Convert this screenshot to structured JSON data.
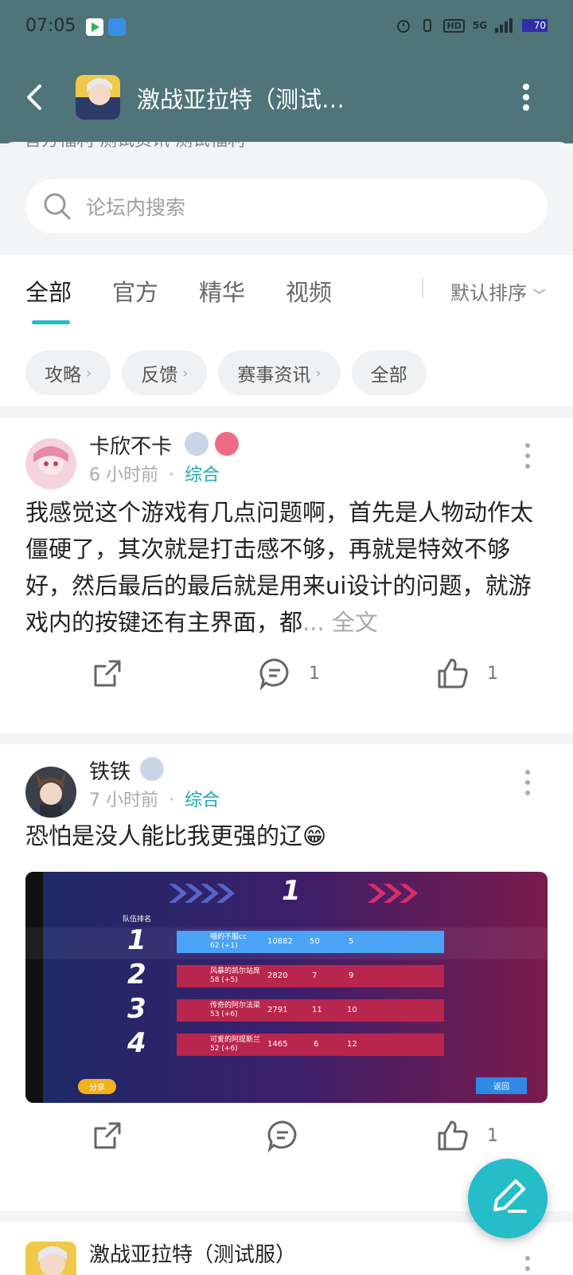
{
  "status": {
    "time": "07:05",
    "battery": "70",
    "net": "5G"
  },
  "header": {
    "title": "激战亚拉特（测试…"
  },
  "subtabs_peek": "官方福利    测试资讯    测试福利",
  "search": {
    "placeholder": "论坛内搜索"
  },
  "tabs": {
    "items": [
      "全部",
      "官方",
      "精华",
      "视频"
    ],
    "active": 0,
    "sort_label": "默认排序"
  },
  "chips": [
    "攻略",
    "反馈",
    "赛事资讯",
    "全部"
  ],
  "posts": [
    {
      "user": "卡欣不卡",
      "time": "6 小时前",
      "dot": "·",
      "category": "综合",
      "text": "我感觉这个游戏有几点问题啊，首先是人物动作太僵硬了，其次就是打击感不够，再就是特效不够好，然后最后的最后就是用来ui设计的问题，就游戏内的按键还有主界面，都",
      "more": "... 全文",
      "comments": "1",
      "likes": "1"
    },
    {
      "user": "铁铁",
      "time": "7 小时前",
      "dot": "·",
      "category": "综合",
      "text": "恐怕是没人能比我更强的辽😁",
      "likes": "1",
      "screenshot": {
        "rank_title": "1",
        "header_label": "队伍排名",
        "share": "分享",
        "return": "返回",
        "rows": [
          {
            "rank": "1",
            "name": "喵的不服cc",
            "score": "10882",
            "k": "50",
            "d": "5",
            "lvl": "62 (+1)"
          },
          {
            "rank": "2",
            "name": "风暴的凯尔站席",
            "score": "2820",
            "k": "7",
            "d": "9",
            "lvl": "58 (+5)"
          },
          {
            "rank": "3",
            "name": "传奇的阿尔法梁",
            "score": "2791",
            "k": "11",
            "d": "10",
            "lvl": "53 (+6)"
          },
          {
            "rank": "4",
            "name": "可爱的阿提斯兰",
            "score": "1465",
            "k": "6",
            "d": "12",
            "lvl": "52 (+6)"
          }
        ]
      }
    },
    {
      "user": "激战亚拉特（测试服）"
    }
  ],
  "colors": {
    "accent": "#24bcc6",
    "header_bg": "#4f7479"
  }
}
